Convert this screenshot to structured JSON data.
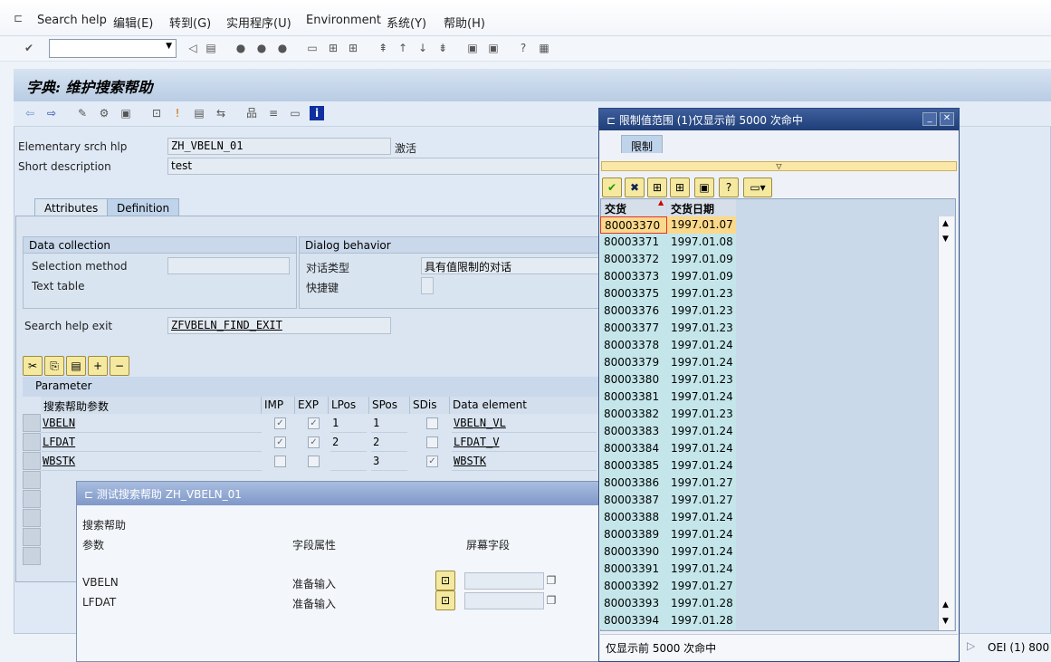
{
  "menu": [
    "Search help",
    "编辑(E)",
    "转到(G)",
    "实用程序(U)",
    "Environment",
    "系统(Y)",
    "帮助(H)"
  ],
  "screen_title": "字典: 维护搜索帮助",
  "header": {
    "srch_label": "Elementary srch hlp",
    "srch_value": "ZH_VBELN_01",
    "status": "激活",
    "desc_label": "Short description",
    "desc_value": "test"
  },
  "tabs": [
    "Attributes",
    "Definition"
  ],
  "data_collection": {
    "title": "Data collection",
    "selection_method": "Selection method",
    "text_table": "Text table"
  },
  "dialog_behavior": {
    "title": "Dialog behavior",
    "dialog_type_label": "对话类型",
    "dialog_type_value": "具有值限制的对话",
    "hotkey_label": "快捷键"
  },
  "exit": {
    "label": "Search help exit",
    "value": "ZFVBELN_FIND_EXIT"
  },
  "parameter": {
    "title": "Parameter",
    "columns": [
      "搜索帮助参数",
      "IMP",
      "EXP",
      "LPos",
      "SPos",
      "SDis",
      "Data element"
    ],
    "rows": [
      {
        "name": "VBELN",
        "imp": true,
        "exp": true,
        "lpos": "1",
        "spos": "1",
        "sdis": false,
        "elem": "VBELN_VL"
      },
      {
        "name": "LFDAT",
        "imp": true,
        "exp": true,
        "lpos": "2",
        "spos": "2",
        "sdis": false,
        "elem": "LFDAT_V"
      },
      {
        "name": "WBSTK",
        "imp": false,
        "exp": false,
        "lpos": "",
        "spos": "3",
        "sdis": true,
        "elem": "WBSTK"
      }
    ]
  },
  "test_dialog": {
    "title": "测试搜索帮助 ZH_VBELN_01",
    "section": "搜索帮助",
    "col_param": "参数",
    "col_attr": "字段属性",
    "col_screen": "屏幕字段",
    "rows": [
      {
        "param": "VBELN",
        "attr": "准备输入"
      },
      {
        "param": "LFDAT",
        "attr": "准备输入"
      }
    ]
  },
  "popup": {
    "title": "限制值范围 (1)仅显示前 5000 次命中",
    "tab": "限制",
    "columns": [
      "交货",
      "交货日期"
    ],
    "rows": [
      [
        "80003370",
        "1997.01.07"
      ],
      [
        "80003371",
        "1997.01.08"
      ],
      [
        "80003372",
        "1997.01.09"
      ],
      [
        "80003373",
        "1997.01.09"
      ],
      [
        "80003375",
        "1997.01.23"
      ],
      [
        "80003376",
        "1997.01.23"
      ],
      [
        "80003377",
        "1997.01.23"
      ],
      [
        "80003378",
        "1997.01.24"
      ],
      [
        "80003379",
        "1997.01.24"
      ],
      [
        "80003380",
        "1997.01.23"
      ],
      [
        "80003381",
        "1997.01.24"
      ],
      [
        "80003382",
        "1997.01.23"
      ],
      [
        "80003383",
        "1997.01.24"
      ],
      [
        "80003384",
        "1997.01.24"
      ],
      [
        "80003385",
        "1997.01.24"
      ],
      [
        "80003386",
        "1997.01.27"
      ],
      [
        "80003387",
        "1997.01.27"
      ],
      [
        "80003388",
        "1997.01.24"
      ],
      [
        "80003389",
        "1997.01.24"
      ],
      [
        "80003390",
        "1997.01.24"
      ],
      [
        "80003391",
        "1997.01.24"
      ],
      [
        "80003392",
        "1997.01.27"
      ],
      [
        "80003393",
        "1997.01.28"
      ],
      [
        "80003394",
        "1997.01.28"
      ]
    ],
    "status": "仅显示前 5000 次命中"
  },
  "system_status": "OEI (1) 800",
  "colors": {
    "title_bar": "#1f3e78",
    "selected_row": "#fbd98a",
    "key_column": "#c4e6ea",
    "button": "#f5e9a0"
  }
}
